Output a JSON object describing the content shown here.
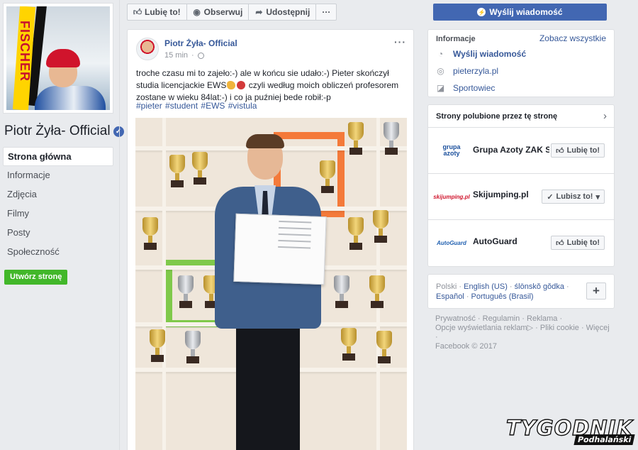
{
  "page": {
    "name": "Piotr Żyła- Official",
    "profile_logo_text": "FISCHER"
  },
  "left_nav": {
    "items": [
      {
        "label": "Strona główna",
        "active": true
      },
      {
        "label": "Informacje"
      },
      {
        "label": "Zdjęcia"
      },
      {
        "label": "Filmy"
      },
      {
        "label": "Posty"
      },
      {
        "label": "Społeczność"
      }
    ],
    "create_page_label": "Utwórz stronę"
  },
  "action_bar": {
    "like_label": "Lubię to!",
    "follow_label": "Obserwuj",
    "share_label": "Udostępnij",
    "more_label": "···",
    "send_message_label": "Wyślij wiadomość"
  },
  "post": {
    "author": "Piotr Żyła- Official",
    "time": "15 min",
    "separator": "·",
    "text_part1": "troche czasu mi to zajeło:-) ale w końcu sie udało:-) Pieter skończył studia licencjackie EWS",
    "text_part2": " czyli według moich obliczeń profesorem zostane w wieku 84lat:-) i co ja puźniej bede robił:-p",
    "hashtags": "#pieter #student #EWS #vistula",
    "options_label": "···"
  },
  "info_card": {
    "title": "Informacje",
    "see_all": "Zobacz wszystkie",
    "send_message": "Wyślij wiadomość",
    "website": "pieterzyla.pl",
    "category": "Sportowiec"
  },
  "liked_pages": {
    "title": "Strony polubione przez tę stronę",
    "items": [
      {
        "name": "Grupa Azoty ZAK S.A.",
        "button": "Lubię to!",
        "logo_text": "grupa azoty",
        "logo_color": "#1a4f9c"
      },
      {
        "name": "Skijumping.pl",
        "button": "Lubisz to!",
        "logo_text": "skijumping.pl",
        "logo_color": "#d0142c"
      },
      {
        "name": "AutoGuard",
        "button": "Lubię to!",
        "logo_text": "AutoGuard",
        "logo_color": "#1f5fb0"
      }
    ]
  },
  "languages": {
    "current": "Polski",
    "line1": [
      "English (US)",
      "ślōnskŏ gŏdka"
    ],
    "line2": [
      "Español",
      "Português (Brasil)"
    ],
    "add_label": "+"
  },
  "footer": {
    "links": [
      "Prywatność",
      "Regulamin",
      "Reklama",
      "Opcje wyświetlania reklam",
      "Pliki cookie",
      "Więcej"
    ],
    "copyright": "Facebook © 2017"
  },
  "watermark": {
    "big": "TYGODNIK",
    "small": "Podhalański"
  },
  "colors": {
    "facebook_blue": "#4267b2",
    "link": "#365899",
    "create_green": "#42b72a",
    "background": "#e9ebee"
  }
}
